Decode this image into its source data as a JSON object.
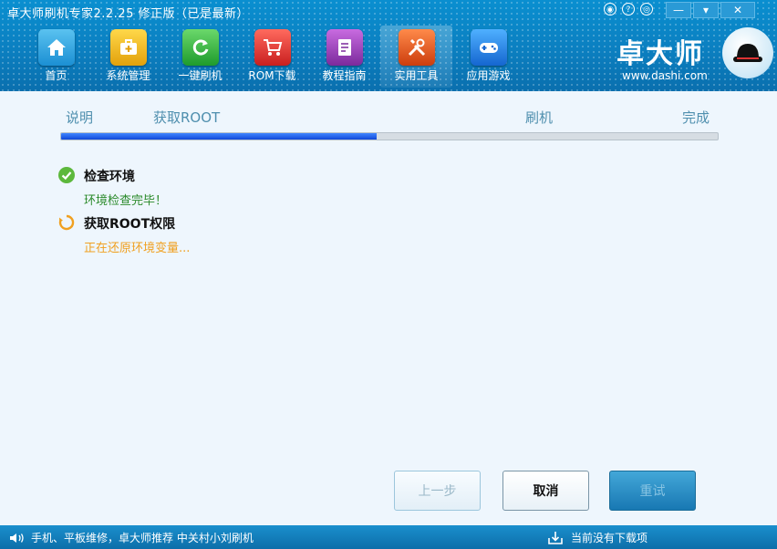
{
  "window": {
    "title": "卓大师刷机专家2.2.25 修正版（已是最新）"
  },
  "window_controls": {
    "minimize": "—",
    "dropdown": "▾",
    "close": "✕"
  },
  "nav": [
    {
      "label": "首页",
      "icon": "home-icon"
    },
    {
      "label": "系统管理",
      "icon": "toolbox-icon"
    },
    {
      "label": "一键刷机",
      "icon": "refresh-icon"
    },
    {
      "label": "ROM下载",
      "icon": "cart-icon"
    },
    {
      "label": "教程指南",
      "icon": "notebook-icon"
    },
    {
      "label": "实用工具",
      "icon": "tools-icon",
      "active": true
    },
    {
      "label": "应用游戏",
      "icon": "gamepad-icon"
    }
  ],
  "logo": {
    "name": "卓大师",
    "url": "www.dashi.com"
  },
  "steps": [
    "说明",
    "获取ROOT",
    "刷机",
    "完成"
  ],
  "progress": {
    "fraction": 0.48
  },
  "tasks": [
    {
      "name": "检查环境",
      "status_text": "环境检查完毕！",
      "state": "done",
      "color": "#2a8a2a"
    },
    {
      "name": "获取ROOT权限",
      "status_text": "正在还原环境变量...",
      "state": "in-progress",
      "color": "#f0a020"
    }
  ],
  "buttons": {
    "prev": "上一步",
    "cancel": "取消",
    "retry": "重试"
  },
  "statusbar": {
    "left_text": "手机、平板维修，卓大师推荐 中关村小刘刷机",
    "right_text": "当前没有下载项"
  }
}
